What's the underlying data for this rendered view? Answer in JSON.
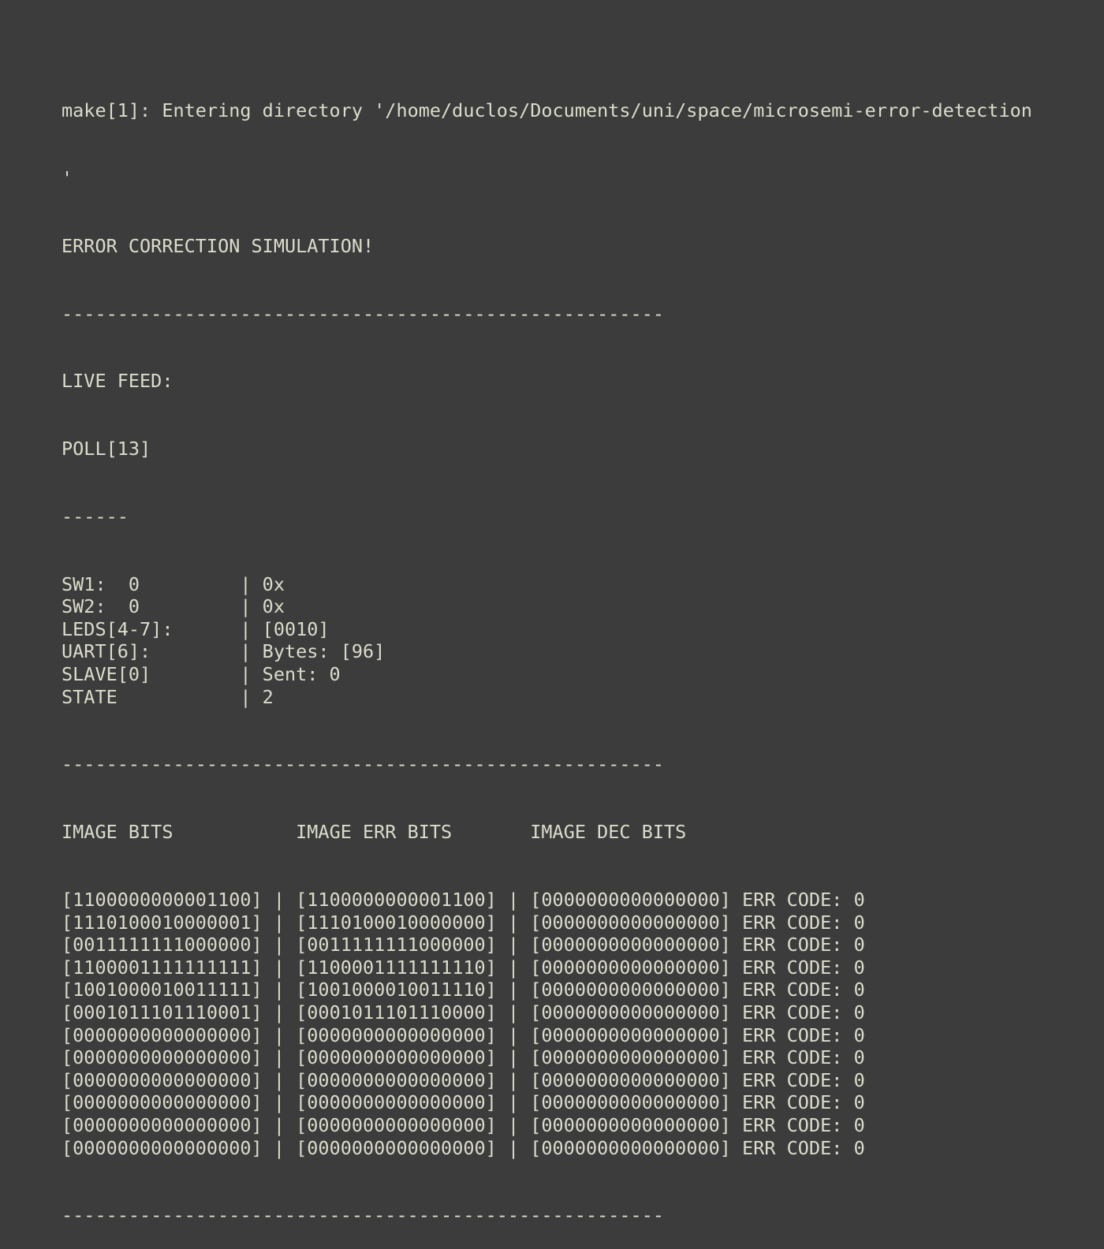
{
  "terminal": {
    "entering": "make[1]: Entering directory '/home/duclos/Documents/uni/space/microsemi-error-detection",
    "entering_cont": "'",
    "title": "ERROR CORRECTION SIMULATION!",
    "separator": "------------------------------------------------------",
    "live_feed": "LIVE FEED:",
    "poll": "POLL[13]",
    "short_separator": "------",
    "status_rows": [
      {
        "label": "SW1:  0         ",
        "value": "0x"
      },
      {
        "label": "SW2:  0         ",
        "value": "0x"
      },
      {
        "label": "LEDS[4-7]:      ",
        "value": "[0010]"
      },
      {
        "label": "UART[6]:        ",
        "value": "Bytes: [96]"
      },
      {
        "label": "SLAVE[0]        ",
        "value": "Sent: 0"
      },
      {
        "label": "STATE           ",
        "value": "2"
      }
    ],
    "headers": {
      "image_bits": "IMAGE BITS",
      "image_err_bits": "IMAGE ERR BITS",
      "image_dec_bits": "IMAGE DEC BITS"
    },
    "bit_rows": [
      {
        "bits": "1100000000001100",
        "err_bits": "1100000000001100",
        "dec_bits": "0000000000000000",
        "err_code": "0"
      },
      {
        "bits": "1110100010000001",
        "err_bits": "1110100010000000",
        "dec_bits": "0000000000000000",
        "err_code": "0"
      },
      {
        "bits": "0011111111000000",
        "err_bits": "0011111111000000",
        "dec_bits": "0000000000000000",
        "err_code": "0"
      },
      {
        "bits": "1100001111111111",
        "err_bits": "1100001111111110",
        "dec_bits": "0000000000000000",
        "err_code": "0"
      },
      {
        "bits": "1001000010011111",
        "err_bits": "1001000010011110",
        "dec_bits": "0000000000000000",
        "err_code": "0"
      },
      {
        "bits": "0001011101110001",
        "err_bits": "0001011101110000",
        "dec_bits": "0000000000000000",
        "err_code": "0"
      },
      {
        "bits": "0000000000000000",
        "err_bits": "0000000000000000",
        "dec_bits": "0000000000000000",
        "err_code": "0"
      },
      {
        "bits": "0000000000000000",
        "err_bits": "0000000000000000",
        "dec_bits": "0000000000000000",
        "err_code": "0"
      },
      {
        "bits": "0000000000000000",
        "err_bits": "0000000000000000",
        "dec_bits": "0000000000000000",
        "err_code": "0"
      },
      {
        "bits": "0000000000000000",
        "err_bits": "0000000000000000",
        "dec_bits": "0000000000000000",
        "err_code": "0"
      },
      {
        "bits": "0000000000000000",
        "err_bits": "0000000000000000",
        "dec_bits": "0000000000000000",
        "err_code": "0"
      },
      {
        "bits": "0000000000000000",
        "err_bits": "0000000000000000",
        "dec_bits": "0000000000000000",
        "err_code": "0"
      }
    ],
    "err_code_label": "ERR CODE: "
  }
}
